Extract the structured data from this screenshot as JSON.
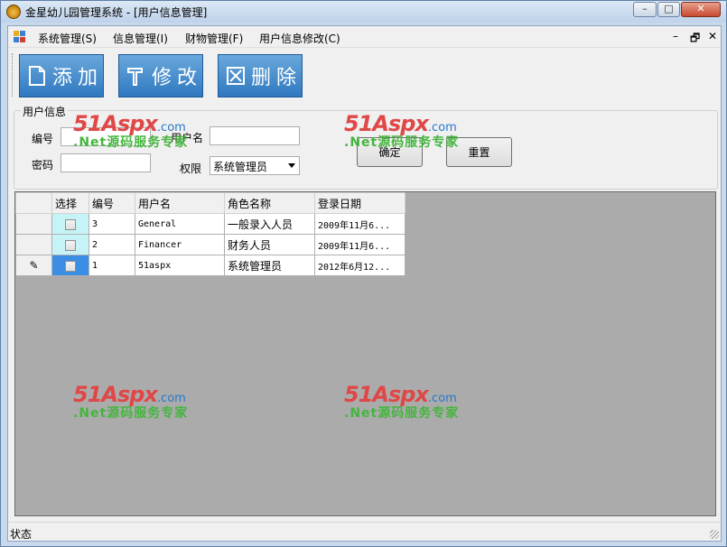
{
  "window": {
    "title": "金星幼儿园管理系统 - [用户信息管理]",
    "min_glyph": "–",
    "max_glyph": "□",
    "close_glyph": "✕"
  },
  "menu": {
    "items": [
      "系统管理(S)",
      "信息管理(I)",
      "财物管理(F)",
      "用户信息修改(C)"
    ],
    "mdi_min": "–",
    "mdi_restore": "🗗",
    "mdi_close": "✕"
  },
  "toolbar": {
    "add_label": "添加",
    "edit_label": "修改",
    "delete_label": "删除",
    "add_icon": "document-icon",
    "edit_icon": "hammer-icon",
    "delete_icon": "delete-box-icon"
  },
  "user_form": {
    "group_title": "用户信息",
    "id_label": "编号",
    "id_value": "",
    "password_label": "密码",
    "password_value": "",
    "username_label": "用户名",
    "username_value": "",
    "permission_label": "权限",
    "permission_value": "系统管理员",
    "confirm_label": "确定",
    "reset_label": "重置"
  },
  "grid": {
    "columns": [
      "选择",
      "编号",
      "用户名",
      "角色名称",
      "登录日期"
    ],
    "rows": [
      {
        "id": "3",
        "username": "General",
        "role": "一般录入人员",
        "date": "2009年11月6..."
      },
      {
        "id": "2",
        "username": "Financer",
        "role": "财务人员",
        "date": "2009年11月6..."
      },
      {
        "id": "1",
        "username": "51aspx",
        "role": "系统管理员",
        "date": "2012年6月12..."
      }
    ],
    "edit_row_glyph": "✎"
  },
  "status": {
    "text": "状态"
  },
  "watermark": {
    "brand": "51Aspx",
    "suffix": ".com",
    "tagline": ".Net源码服务专家"
  },
  "colors": {
    "toolbar_button": "#2f78c0",
    "grid_background": "#ababab",
    "checkbox_cell": "#c6f4f6",
    "selected_cell": "#3b8ee3"
  }
}
